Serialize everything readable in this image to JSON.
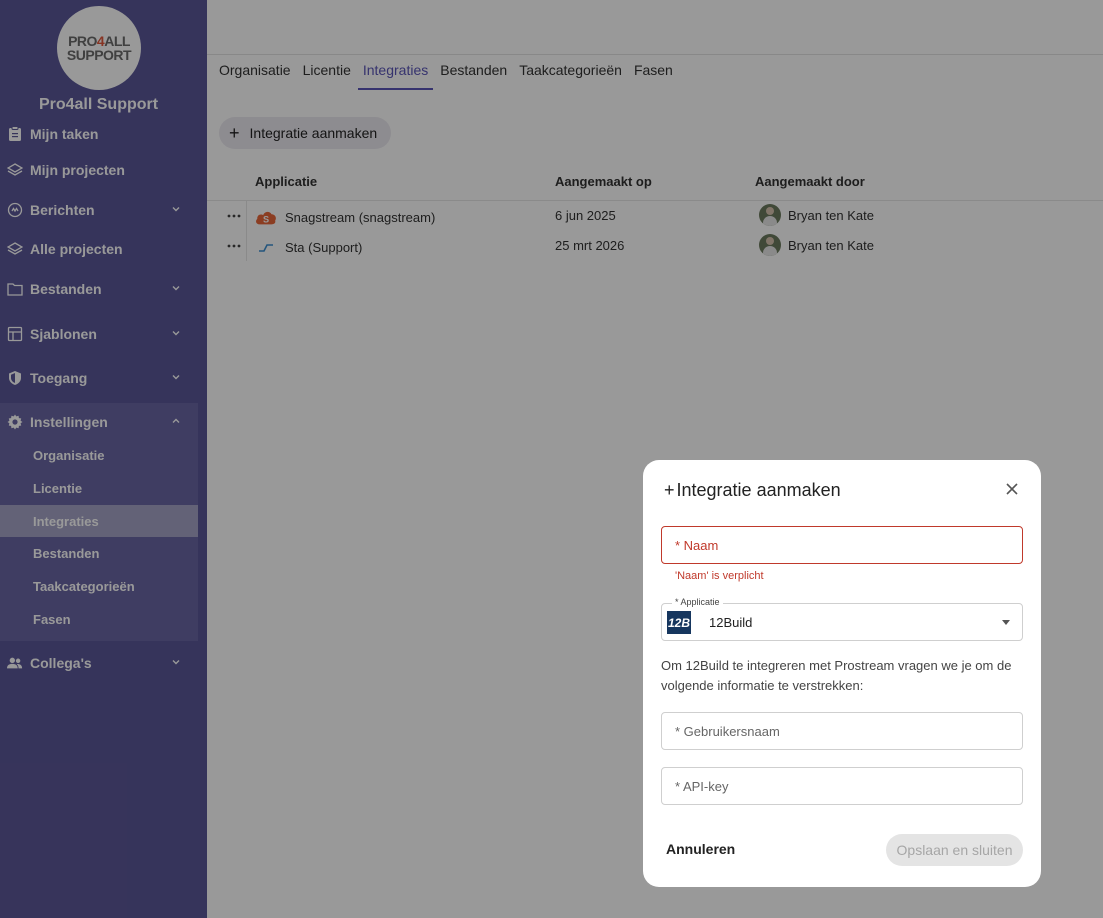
{
  "sidebar": {
    "logo_line1_a": "PRO",
    "logo_line1_b": "4",
    "logo_line1_c": "ALL",
    "logo_line2": "SUPPORT",
    "org_name": "Pro4all Support",
    "items": {
      "my_tasks": "Mijn taken",
      "my_projects": "Mijn projecten",
      "messages": "Berichten",
      "all_projects": "Alle projecten",
      "files": "Bestanden",
      "templates": "Sjablonen",
      "access": "Toegang",
      "settings": "Instellingen",
      "colleagues": "Collega's"
    },
    "settings_sub": {
      "organisation": "Organisatie",
      "license": "Licentie",
      "integrations": "Integraties",
      "files": "Bestanden",
      "task_categories": "Taakcategorieën",
      "phases": "Fasen"
    }
  },
  "main": {
    "tabs": {
      "organisation": "Organisatie",
      "license": "Licentie",
      "integrations": "Integraties",
      "files": "Bestanden",
      "task_categories": "Taakcategorieën",
      "phases": "Fasen"
    },
    "create_button": "Integratie aanmaken",
    "table": {
      "headers": {
        "application": "Applicatie",
        "created_on": "Aangemaakt op",
        "created_by": "Aangemaakt door"
      },
      "rows": [
        {
          "application": "Snagstream (snagstream)",
          "created_on": "6 jun 2025",
          "created_by": "Bryan ten Kate",
          "icon": "snagstream-icon"
        },
        {
          "application": "Sta (Support)",
          "created_on": "25 mrt 2026",
          "created_by": "Bryan ten Kate",
          "icon": "stabu-icon"
        }
      ]
    }
  },
  "modal": {
    "title": "Integratie aanmaken",
    "name_placeholder": "* Naam",
    "name_error": "'Naam' is verplicht",
    "application_label": "* Applicatie",
    "application_value": "12Build",
    "application_logo": "12B",
    "description": "Om 12Build te integreren met Prostream vragen we je om de volgende informatie te verstrekken:",
    "username_placeholder": "* Gebruikersnaam",
    "apikey_placeholder": "* API-key",
    "cancel": "Annuleren",
    "save": "Opslaan en sluiten"
  },
  "colors": {
    "sidebar": "#5b5798",
    "accent": "#5b56b8",
    "error": "#c0392b"
  }
}
